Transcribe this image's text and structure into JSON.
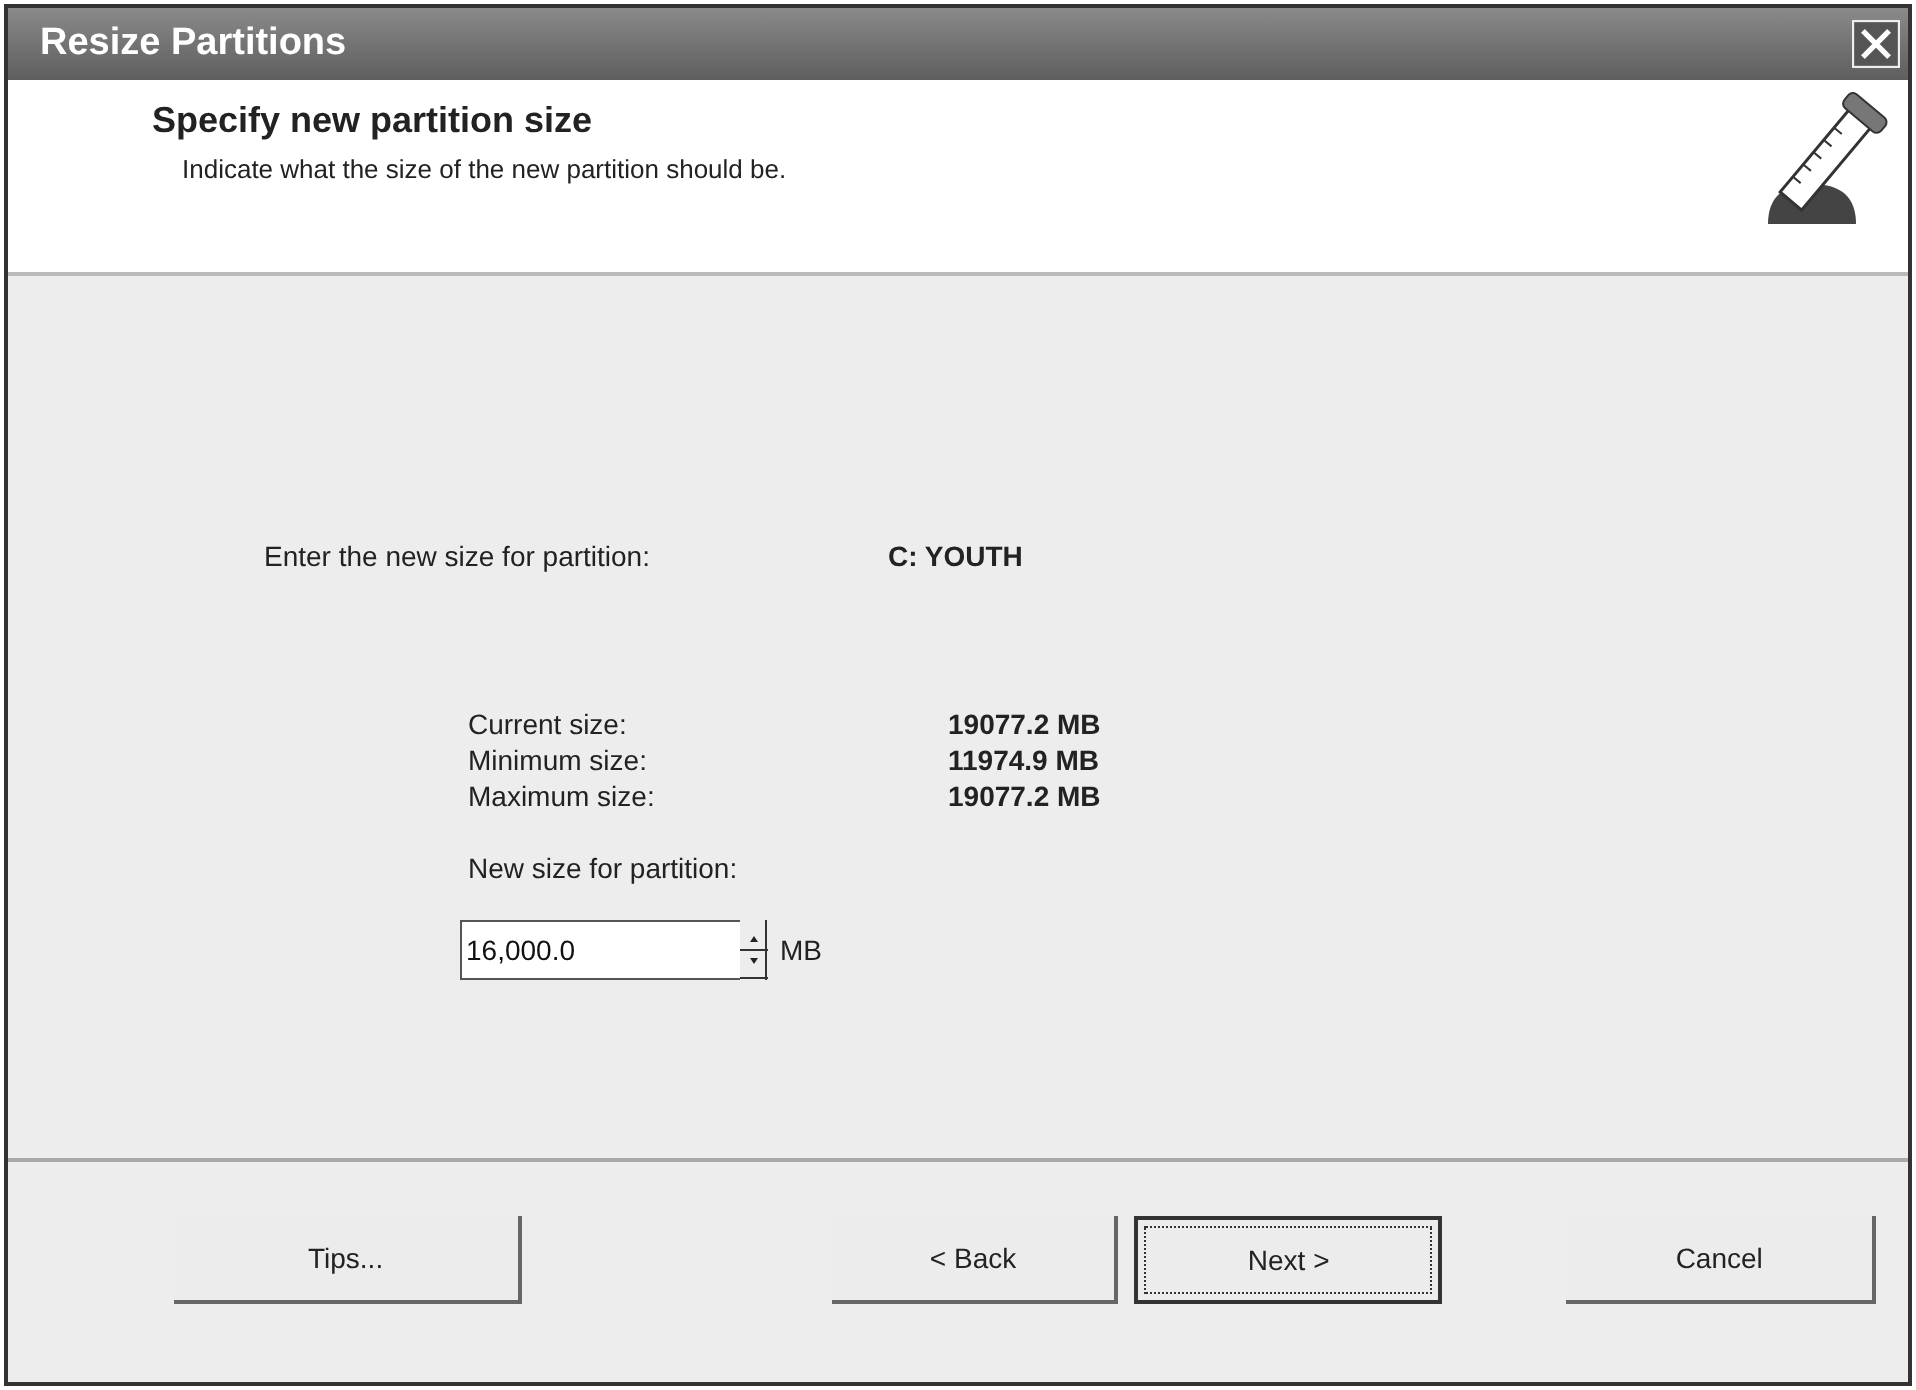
{
  "window": {
    "title": "Resize Partitions"
  },
  "header": {
    "title": "Specify new partition size",
    "subtitle": "Indicate what the size of the new partition should be."
  },
  "partition": {
    "label": "Enter the new size for partition:",
    "value": "C: YOUTH"
  },
  "sizes": [
    {
      "label": "Current size:",
      "value": "19077.2 MB"
    },
    {
      "label": "Minimum size:",
      "value": "11974.9 MB"
    },
    {
      "label": "Maximum size:",
      "value": "19077.2 MB"
    }
  ],
  "new_size": {
    "label": "New size for partition:",
    "value": "16,000.0",
    "unit": "MB"
  },
  "buttons": [
    {
      "label": "Tips...",
      "focused": false
    },
    {
      "label": "< Back",
      "focused": false
    },
    {
      "label": "Next >",
      "focused": true
    },
    {
      "label": "Cancel",
      "focused": false
    }
  ]
}
